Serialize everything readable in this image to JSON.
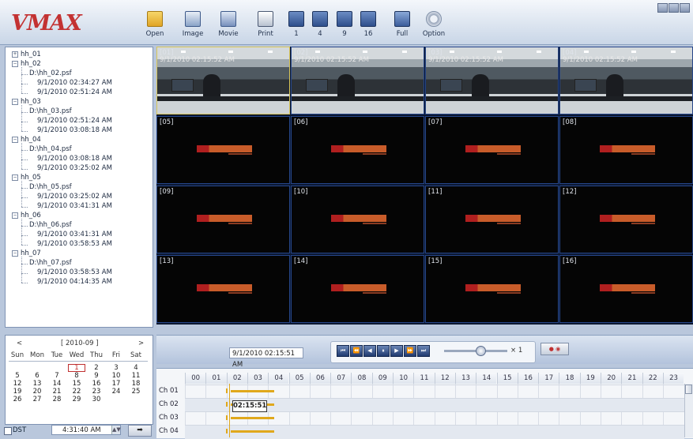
{
  "app": {
    "logo_text": "VMAX"
  },
  "toolbar": {
    "open": "Open",
    "image": "Image",
    "movie": "Movie",
    "print": "Print",
    "split1": "1",
    "split4": "4",
    "split9": "9",
    "split16": "16",
    "full": "Full",
    "option": "Option"
  },
  "tree": [
    {
      "label": "hh_01",
      "expanded": false
    },
    {
      "label": "hh_02",
      "file": "D:\\hh_02.psf",
      "times": [
        "9/1/2010 02:34:27 AM",
        "9/1/2010 02:51:24 AM"
      ]
    },
    {
      "label": "hh_03",
      "file": "D:\\hh_03.psf",
      "times": [
        "9/1/2010 02:51:24 AM",
        "9/1/2010 03:08:18 AM"
      ]
    },
    {
      "label": "hh_04",
      "file": "D:\\hh_04.psf",
      "times": [
        "9/1/2010 03:08:18 AM",
        "9/1/2010 03:25:02 AM"
      ]
    },
    {
      "label": "hh_05",
      "file": "D:\\hh_05.psf",
      "times": [
        "9/1/2010 03:25:02 AM",
        "9/1/2010 03:41:31 AM"
      ]
    },
    {
      "label": "hh_06",
      "file": "D:\\hh_06.psf",
      "times": [
        "9/1/2010 03:41:31 AM",
        "9/1/2010 03:58:53 AM"
      ]
    },
    {
      "label": "hh_07",
      "file": "D:\\hh_07.psf",
      "times": [
        "9/1/2010 03:58:53 AM",
        "9/1/2010 04:14:35 AM"
      ]
    }
  ],
  "video": {
    "channels": [
      "[01]",
      "[02]",
      "[03]",
      "[04]",
      "[05]",
      "[06]",
      "[07]",
      "[08]",
      "[09]",
      "[10]",
      "[11]",
      "[12]",
      "[13]",
      "[14]",
      "[15]",
      "[16]"
    ],
    "live_timestamp": "9/1/2010 02:15:52 AM",
    "selected": "[01]"
  },
  "calendar": {
    "prev": "<",
    "next": ">",
    "month": "[ 2010-09 ]",
    "days": [
      "Sun",
      "Mon",
      "Tue",
      "Wed",
      "Thu",
      "Fri",
      "Sat"
    ],
    "weeks": [
      [
        "",
        "",
        "",
        "1",
        "2",
        "3",
        "4"
      ],
      [
        "5",
        "6",
        "7",
        "8",
        "9",
        "10",
        "11"
      ],
      [
        "12",
        "13",
        "14",
        "15",
        "16",
        "17",
        "18"
      ],
      [
        "19",
        "20",
        "21",
        "22",
        "23",
        "24",
        "25"
      ],
      [
        "26",
        "27",
        "28",
        "29",
        "30",
        "",
        ""
      ]
    ],
    "selected_day": "1",
    "dst_label": "DST",
    "time": "4:31:40 AM",
    "go": "➡"
  },
  "playback": {
    "current_time": "9/1/2010 02:15:51 AM",
    "speed": "× 1",
    "buttons": [
      "⏮",
      "⏪",
      "◀",
      "⏸",
      "▶",
      "⏩",
      "⏭"
    ]
  },
  "timeline": {
    "hours": [
      "00",
      "01",
      "02",
      "03",
      "04",
      "05",
      "06",
      "07",
      "08",
      "09",
      "10",
      "11",
      "12",
      "13",
      "14",
      "15",
      "16",
      "17",
      "18",
      "19",
      "20",
      "21",
      "22",
      "23"
    ],
    "channels": [
      "Ch 01",
      "Ch 02",
      "Ch 03",
      "Ch 04"
    ],
    "cursor_label": "02:15:51"
  }
}
